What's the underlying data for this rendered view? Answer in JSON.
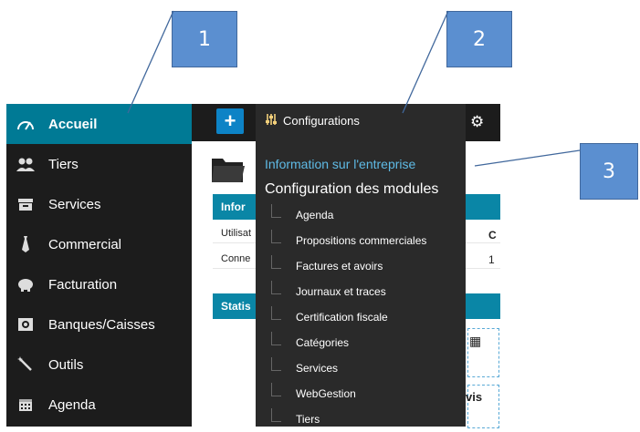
{
  "callouts": {
    "one": "1",
    "two": "2",
    "three": "3"
  },
  "sidebar": {
    "items": [
      {
        "label": "Accueil",
        "icon": "speedometer-icon"
      },
      {
        "label": "Tiers",
        "icon": "users-icon"
      },
      {
        "label": "Services",
        "icon": "box-icon"
      },
      {
        "label": "Commercial",
        "icon": "tie-icon"
      },
      {
        "label": "Facturation",
        "icon": "piggy-bank-icon"
      },
      {
        "label": "Banques/Caisses",
        "icon": "bank-icon"
      },
      {
        "label": "Outils",
        "icon": "magic-wand-icon"
      },
      {
        "label": "Agenda",
        "icon": "calendar-icon"
      }
    ]
  },
  "topbar": {
    "plus": "+",
    "gear": "⚙"
  },
  "content": {
    "info_header": "Infor",
    "rows": [
      "Utilisat",
      "Conne"
    ],
    "rows_right": [
      "C",
      "1"
    ],
    "stat_header": "Statis",
    "partial_text": "vis"
  },
  "dropdown": {
    "title": "Configurations",
    "info": "Information sur l'entreprise",
    "modules": "Configuration des modules",
    "subitems": [
      "Agenda",
      "Propositions commerciales",
      "Factures et avoirs",
      "Journaux et traces",
      "Certification fiscale",
      "Catégories",
      "Services",
      "WebGestion",
      "Tiers"
    ]
  },
  "colors": {
    "accent": "#007a95",
    "sidebar": "#1c1c1c",
    "link": "#5fbbe6",
    "callout": "#5b8fd0"
  }
}
